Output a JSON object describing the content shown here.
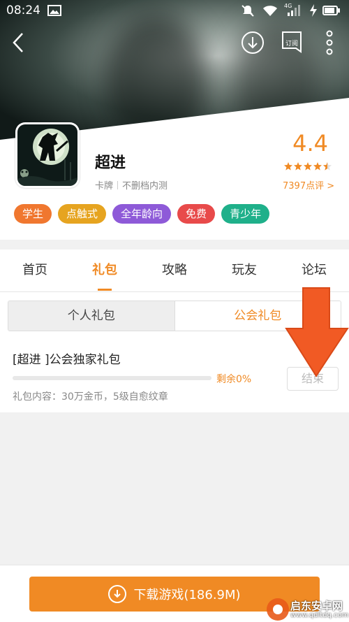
{
  "status_bar": {
    "time": "08:24",
    "network": "4G"
  },
  "header": {
    "subscribe_label": "订阅"
  },
  "app": {
    "name": "超进",
    "category": "卡牌",
    "test_status": "不删档内测",
    "rating": "4.4",
    "stars": 4.5,
    "review_count": "7397点评 >"
  },
  "tags": [
    {
      "label": "学生",
      "color": "#f0772f"
    },
    {
      "label": "点触式",
      "color": "#e6a420"
    },
    {
      "label": "全年龄向",
      "color": "#8e5ad8"
    },
    {
      "label": "免费",
      "color": "#e84a4a"
    },
    {
      "label": "青少年",
      "color": "#1fb08a"
    }
  ],
  "tabs": [
    {
      "label": "首页"
    },
    {
      "label": "礼包",
      "active": true
    },
    {
      "label": "攻略"
    },
    {
      "label": "玩友"
    },
    {
      "label": "论坛"
    }
  ],
  "gift_types": {
    "personal": "个人礼包",
    "guild": "公会礼包"
  },
  "gift": {
    "title": "[超进 ]公会独家礼包",
    "remaining_label": "剩余0%",
    "remaining_fraction": 0,
    "content": "礼包内容：30万金币，5级自愈纹章",
    "action_label": "结束"
  },
  "download": {
    "label": "下载游戏(186.9M)"
  },
  "watermark": {
    "name": "启东安卓网",
    "url": "www.qdltdq.com"
  },
  "colors": {
    "accent": "#f08a24",
    "arrow": "#f15a24"
  }
}
